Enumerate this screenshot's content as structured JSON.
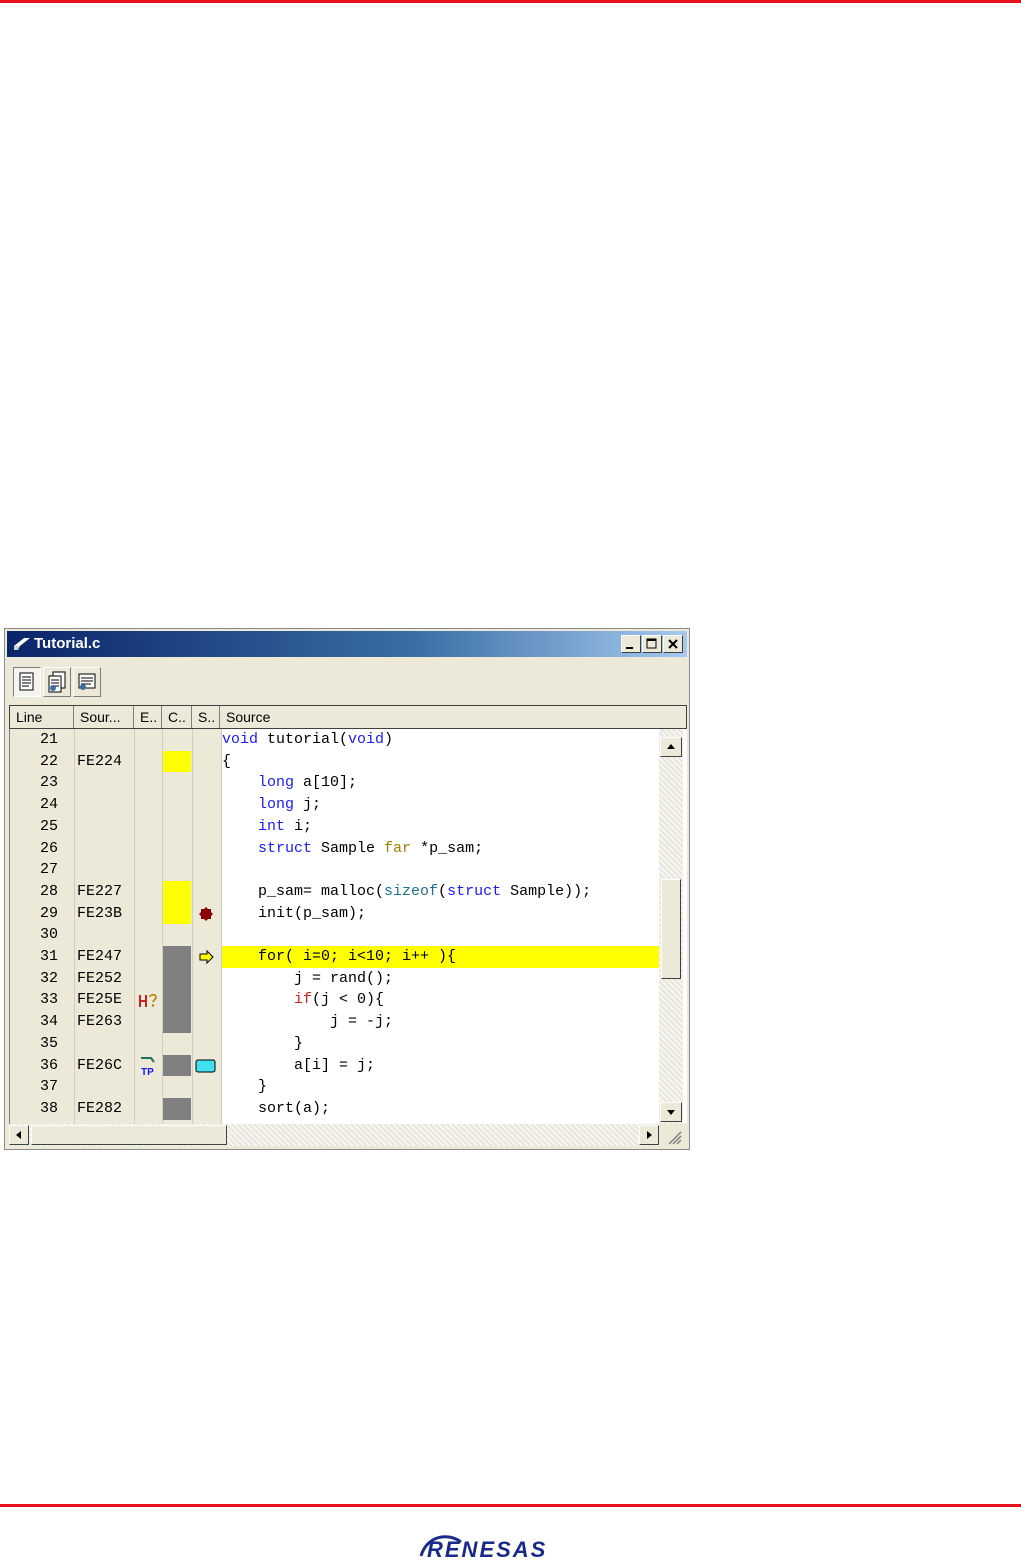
{
  "window": {
    "title": "Tutorial.c"
  },
  "toolbar": {
    "buttons": [
      {
        "icon": "source-mode-icon"
      },
      {
        "icon": "disassembly-mode-icon"
      },
      {
        "icon": "mixed-mode-icon"
      }
    ]
  },
  "columns": [
    "Line",
    "Sour...",
    "E..",
    "C..",
    "S..",
    "Source"
  ],
  "rows": [
    {
      "line": "21",
      "addr": "",
      "code": "void tutorial(void)"
    },
    {
      "line": "22",
      "addr": "FE224",
      "code": "{"
    },
    {
      "line": "23",
      "addr": "",
      "code": "    long a[10];"
    },
    {
      "line": "24",
      "addr": "",
      "code": "    long j;"
    },
    {
      "line": "25",
      "addr": "",
      "code": "    int i;"
    },
    {
      "line": "26",
      "addr": "",
      "code": "    struct Sample far *p_sam;"
    },
    {
      "line": "27",
      "addr": "",
      "code": ""
    },
    {
      "line": "28",
      "addr": "FE227",
      "code": "    p_sam= malloc(sizeof(struct Sample));"
    },
    {
      "line": "29",
      "addr": "FE23B",
      "code": "    init(p_sam);"
    },
    {
      "line": "30",
      "addr": "",
      "code": ""
    },
    {
      "line": "31",
      "addr": "FE247",
      "code": "    for( i=0; i<10; i++ ){"
    },
    {
      "line": "32",
      "addr": "FE252",
      "code": "        j = rand();"
    },
    {
      "line": "33",
      "addr": "FE25E",
      "code": "        if(j < 0){"
    },
    {
      "line": "34",
      "addr": "FE263",
      "code": "            j = -j;"
    },
    {
      "line": "35",
      "addr": "",
      "code": "        }"
    },
    {
      "line": "36",
      "addr": "FE26C",
      "code": "        a[i] = j;"
    },
    {
      "line": "37",
      "addr": "",
      "code": "    }"
    },
    {
      "line": "38",
      "addr": "FE282",
      "code": "    sort(a);"
    }
  ],
  "markers": {
    "event_line_33": "hardware-break-icon",
    "event_line_36": "trace-point-icon",
    "status_line_29": "breakpoint-icon",
    "status_line_31": "program-counter-arrow-icon",
    "status_line_36": "bookmark-icon"
  },
  "colors": {
    "highlight": "#ffff00",
    "coverage_executed": "#ffff00",
    "coverage_not_executed": "#808080",
    "keyword": "#1a1aff",
    "breakpoint": "#8b0000",
    "brand_red": "#e8101a"
  },
  "brand": {
    "logo_text": "RENESAS"
  }
}
